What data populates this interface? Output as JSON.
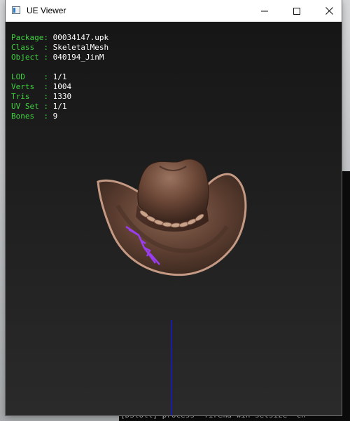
{
  "window": {
    "title": "UE Viewer"
  },
  "info": {
    "rows_group1": [
      {
        "key": "Package: ",
        "value": "00034147.upk"
      },
      {
        "key": "Class  : ",
        "value": "SkeletalMesh"
      },
      {
        "key": "Object : ",
        "value": "040194_JinM"
      }
    ],
    "rows_group2": [
      {
        "key": "LOD    : ",
        "value": "1/1"
      },
      {
        "key": "Verts  : ",
        "value": "1004"
      },
      {
        "key": "Tris   : ",
        "value": "1330"
      },
      {
        "key": "UV Set : ",
        "value": "1/1"
      },
      {
        "key": "Bones  : ",
        "value": "9"
      }
    ]
  },
  "console": {
    "bottom_line": "[DStoll] process  firema wih setsize  cn"
  },
  "colors": {
    "key_green": "#3fd13f",
    "value_white": "#ffffff",
    "viewport_bg": "#202020",
    "axis_blue": "#1a1aa8",
    "bone_purple": "#9a3cf0",
    "hat_brown": "#6b4a3a"
  },
  "icons": {
    "app": "ue-viewer-app-icon",
    "minimize": "minimize-icon",
    "maximize": "maximize-icon",
    "close": "close-icon"
  }
}
